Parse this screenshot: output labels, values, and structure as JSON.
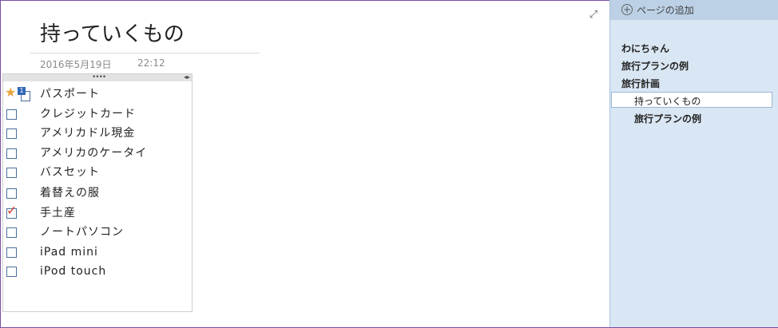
{
  "page": {
    "title": "持っていくもの",
    "date": "2016年5月19日",
    "time": "22:12"
  },
  "toolbar": {
    "expand_icon": "expand-icon"
  },
  "note": {
    "items": [
      {
        "label": "パスポート",
        "state": "tagged",
        "tag_icon": "star-icon",
        "badge": "1"
      },
      {
        "label": "クレジットカード",
        "state": "unchecked"
      },
      {
        "label": "アメリカドル現金",
        "state": "unchecked"
      },
      {
        "label": "アメリカのケータイ",
        "state": "unchecked"
      },
      {
        "label": "バスセット",
        "state": "unchecked"
      },
      {
        "label": "着替えの服",
        "state": "unchecked"
      },
      {
        "label": "手土産",
        "state": "checked"
      },
      {
        "label": "ノートパソコン",
        "state": "unchecked"
      },
      {
        "label": "iPad mini",
        "state": "unchecked"
      },
      {
        "label": "iPod touch",
        "state": "unchecked"
      }
    ]
  },
  "sidebar": {
    "add_page_label": "ページの追加",
    "pages": [
      {
        "label": "わにちゃん",
        "level": 0
      },
      {
        "label": "旅行プランの例",
        "level": 0
      },
      {
        "label": "旅行計画",
        "level": 0
      },
      {
        "label": "持っていくもの",
        "level": 1,
        "selected": true
      },
      {
        "label": "旅行プランの例",
        "level": 1
      }
    ]
  },
  "colors": {
    "sidebar_bg": "#d9e6f3",
    "add_page_bg": "#bcd1e6",
    "checkbox_border": "#4a6e9a",
    "checkmark": "#d33c2e",
    "star": "#e6a63c",
    "window_border": "#7a4ea3"
  }
}
